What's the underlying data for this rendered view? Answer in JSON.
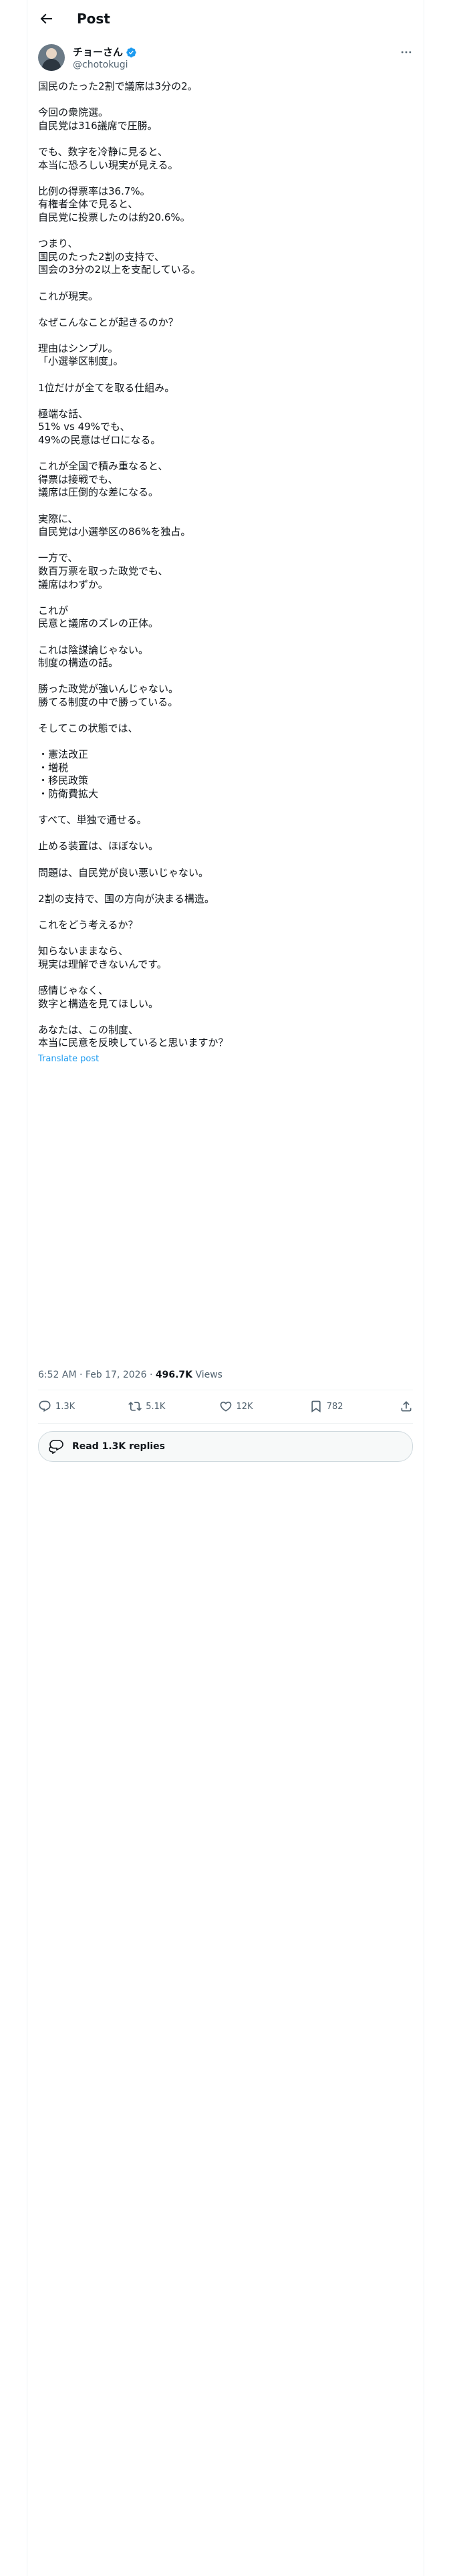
{
  "header": {
    "title": "Post"
  },
  "author": {
    "display_name": "チョーさん",
    "handle": "@chotokugi"
  },
  "post": {
    "paragraphs": [
      [
        "国民のたった2割で議席は3分の2。"
      ],
      [
        "今回の衆院選。",
        "自民党は316議席で圧勝。"
      ],
      [
        "でも、数字を冷静に見ると、",
        "本当に恐ろしい現実が見える。"
      ],
      [
        "比例の得票率は36.7%。",
        "有権者全体で見ると、",
        "自民党に投票したのは約20.6%。"
      ],
      [
        "つまり、",
        "国民のたった2割の支持で、",
        "国会の3分の2以上を支配している。"
      ],
      [
        "これが現実。"
      ],
      [
        "なぜこんなことが起きるのか？"
      ],
      [
        "理由はシンプル。",
        "「小選挙区制度」。"
      ],
      [
        "1位だけが全てを取る仕組み。"
      ],
      [
        "極端な話、",
        "51% vs 49%でも、",
        "49%の民意はゼロになる。"
      ],
      [
        "これが全国で積み重なると、",
        "得票は接戦でも、",
        "議席は圧倒的な差になる。"
      ],
      [
        "実際に、",
        "自民党は小選挙区の86%を独占。"
      ],
      [
        "一方で、",
        "数百万票を取った政党でも、",
        "議席はわずか。"
      ],
      [
        "これが",
        "民意と議席のズレの正体。"
      ],
      [
        "これは陰謀論じゃない。",
        "制度の構造の話。"
      ],
      [
        "勝った政党が強いんじゃない。",
        "勝てる制度の中で勝っている。"
      ],
      [
        "そしてこの状態では、"
      ],
      [
        "・憲法改正",
        "・増税",
        "・移民政策",
        "・防衛費拡大"
      ],
      [
        "すべて、単独で通せる。"
      ],
      [
        "止める装置は、ほぼない。"
      ],
      [
        "問題は、自民党が良い悪いじゃない。"
      ],
      [
        "2割の支持で、国の方向が決まる構造。"
      ],
      [
        "これをどう考えるか？"
      ],
      [
        "知らないままなら、",
        "現実は理解できないんです。"
      ],
      [
        "感情じゃなく、",
        "数字と構造を見てほしい。"
      ],
      [
        "あなたは、この制度、",
        "本当に民意を反映していると思いますか？"
      ]
    ],
    "translate_label": "Translate post"
  },
  "meta": {
    "time": "6:52 AM",
    "date": "Feb 17, 2026",
    "separator": "·",
    "views_count": "496.7K",
    "views_label": "Views"
  },
  "actions": {
    "replies": "1.3K",
    "reposts": "5.1K",
    "likes": "12K",
    "bookmarks": "782"
  },
  "read_replies_label": "Read 1.3K replies",
  "colors": {
    "accent": "#1d9bf0",
    "text": "#0f1419",
    "secondary": "#536471",
    "border": "#eff3f4"
  }
}
